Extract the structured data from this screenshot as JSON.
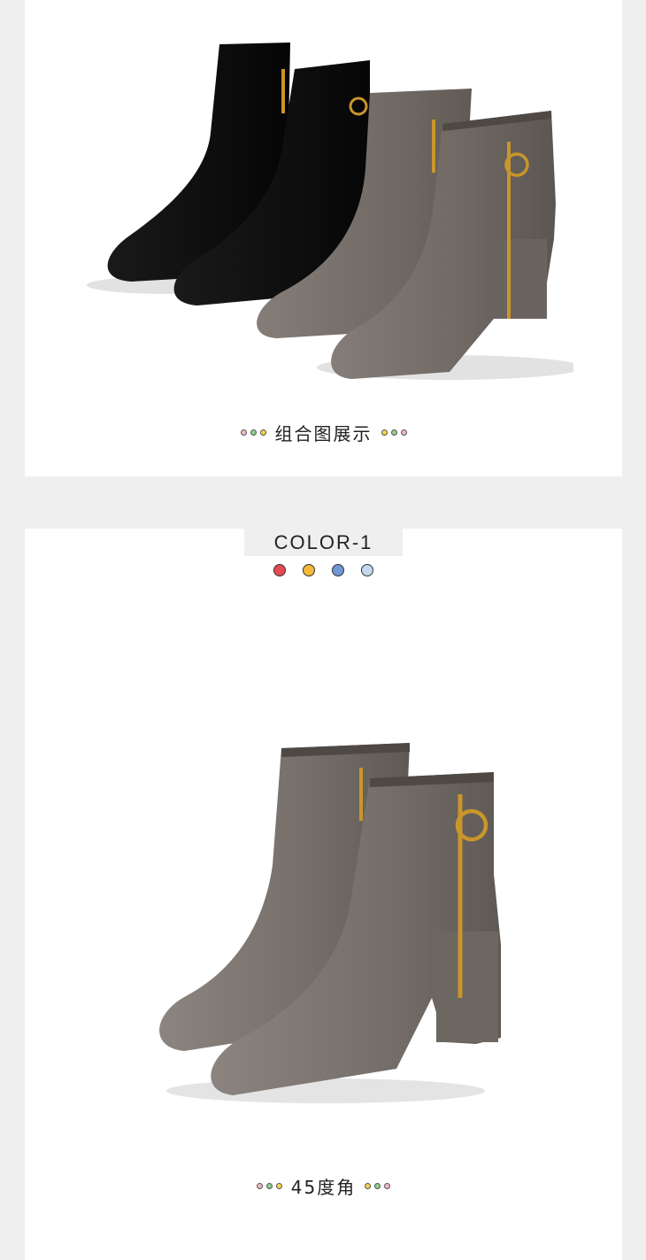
{
  "combo": {
    "caption": "组合图展示",
    "left_dots": [
      "#f3b7bf",
      "#8fcf8f",
      "#f5d44a"
    ],
    "right_dots": [
      "#f5d44a",
      "#8fcf8f",
      "#f3b7bf"
    ]
  },
  "color_section": {
    "tab_label": "COLOR-1",
    "swatches": [
      "#e84a52",
      "#f5b838",
      "#6f96d6",
      "#c4d9ef"
    ],
    "caption": "45度角",
    "left_dots": [
      "#f3b7bf",
      "#8fcf8f",
      "#f5d44a"
    ],
    "right_dots": [
      "#f5d44a",
      "#8fcf8f",
      "#f3b7bf"
    ]
  }
}
